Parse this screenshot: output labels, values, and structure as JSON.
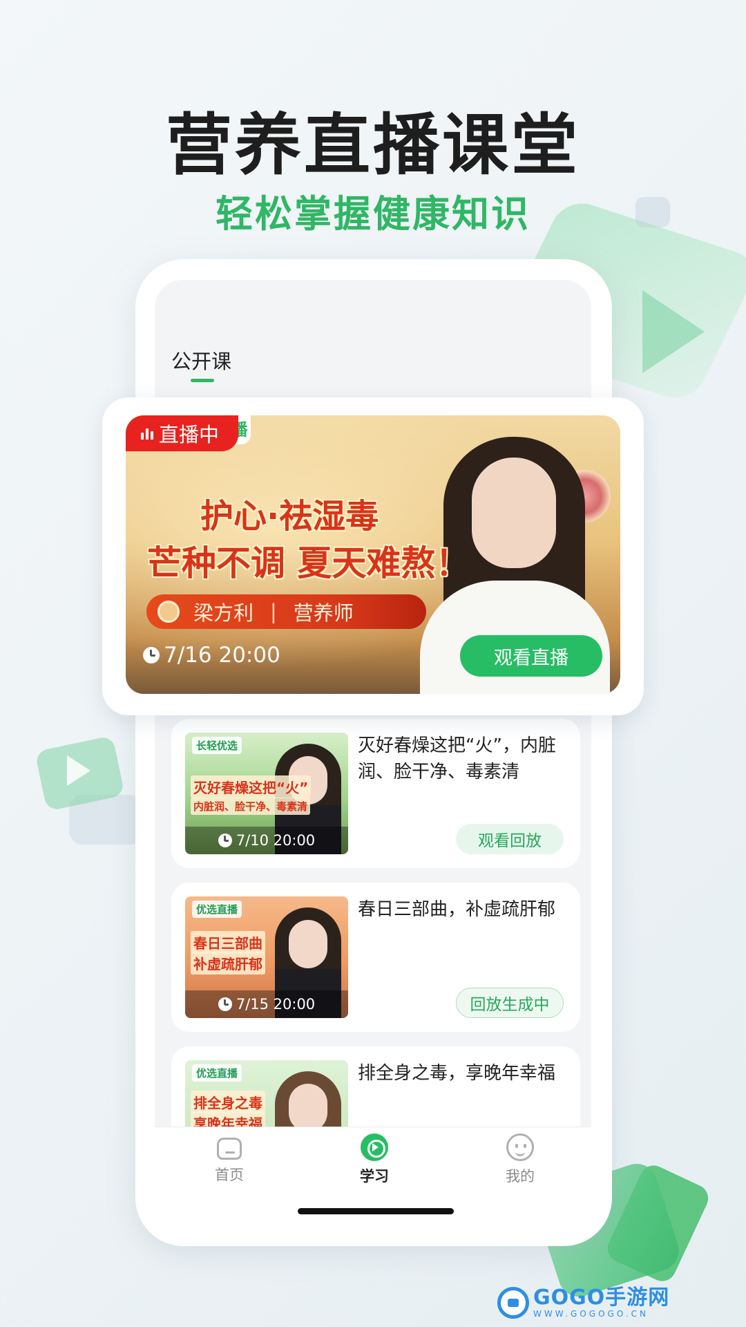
{
  "hero": {
    "title": "营养直播课堂",
    "subtitle": "轻松掌握健康知识"
  },
  "tabs": {
    "active": "公开课"
  },
  "featured": {
    "status_badge": "直播中",
    "badge_tail": "播",
    "headline_line1": "护心·祛湿毒",
    "headline_line2": "芒种不调 夏天难熬！",
    "speaker_name": "梁方利",
    "speaker_sep": "|",
    "speaker_role": "营养师",
    "time": "7/16 20:00",
    "button": "观看直播"
  },
  "courses": [
    {
      "thumb_tag": "长轻优选",
      "thumb_headline_1": "灭好春燥这把“火”",
      "thumb_headline_2": "内脏润、脸干净、毒素清",
      "thumb_time": "7/10 20:00",
      "title": "灭好春燥这把“火”，内脏润、脸干净、毒素清",
      "button": "观看回放"
    },
    {
      "thumb_tag": "优选直播",
      "thumb_headline_1": "春日三部曲",
      "thumb_headline_2": "补虚疏肝郁",
      "thumb_time": "7/15 20:00",
      "title": "春日三部曲，补虚疏肝郁",
      "button": "回放生成中"
    },
    {
      "thumb_tag": "优选直播",
      "thumb_headline_1": "排全身之毒",
      "thumb_headline_2": "享晚年幸福",
      "title": "排全身之毒，享晚年幸福"
    }
  ],
  "nav": {
    "home": "首页",
    "learn": "学习",
    "me": "我的"
  },
  "watermark": {
    "name": "GOGO手游网",
    "url": "WWW.GOGOGO.CN"
  },
  "colors": {
    "accent_green": "#2fb765",
    "live_red": "#e8231f"
  }
}
